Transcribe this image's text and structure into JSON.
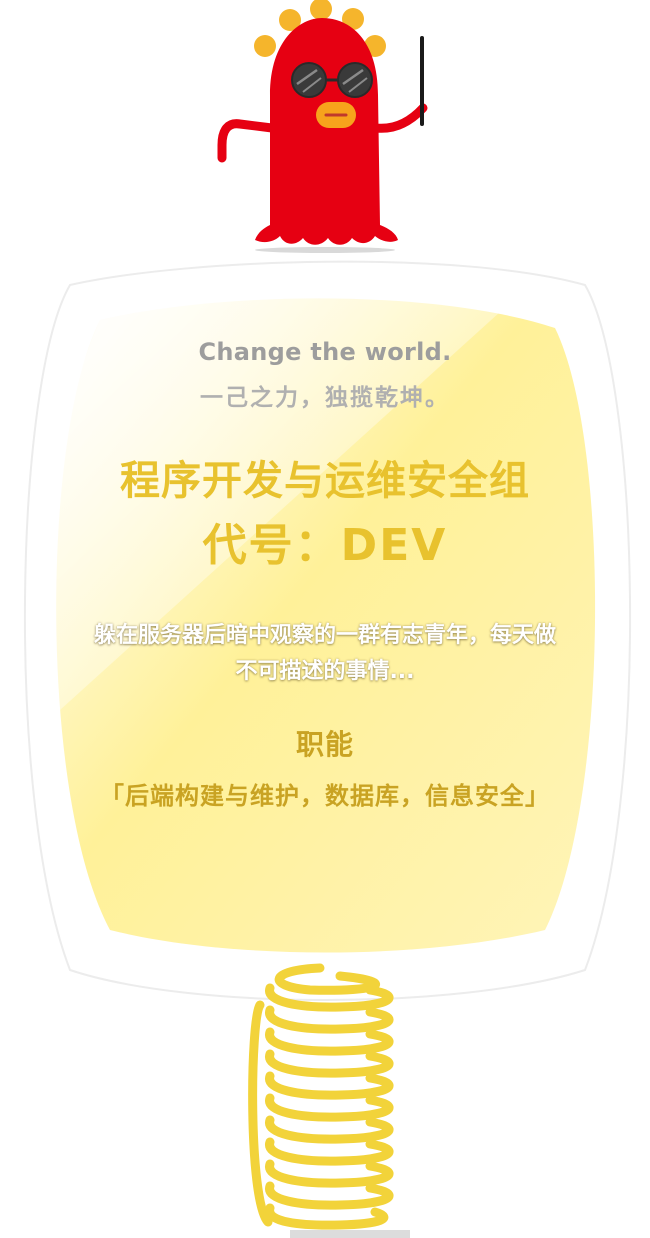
{
  "slogan": {
    "english": "Change the world.",
    "chinese": "一己之力，独揽乾坤。"
  },
  "team": {
    "name": "程序开发与运维安全组",
    "code": "代号：DEV",
    "description": "躲在服务器后暗中观察的一群有志青年，每天做不可描述的事情..."
  },
  "function": {
    "title": "职能",
    "text": "「后端构建与维护，数据库，信息安全」"
  },
  "colors": {
    "mascot_red": "#e60012",
    "mascot_crown": "#f5b52c",
    "mouth_orange": "#f7a31c",
    "card_yellow": "#fff4a8",
    "accent_yellow": "#e8c22e",
    "spring_yellow": "#f2d33a"
  },
  "icons": {
    "mascot": "red-ghost-mascot-icon",
    "spring": "coil-spring-icon"
  }
}
